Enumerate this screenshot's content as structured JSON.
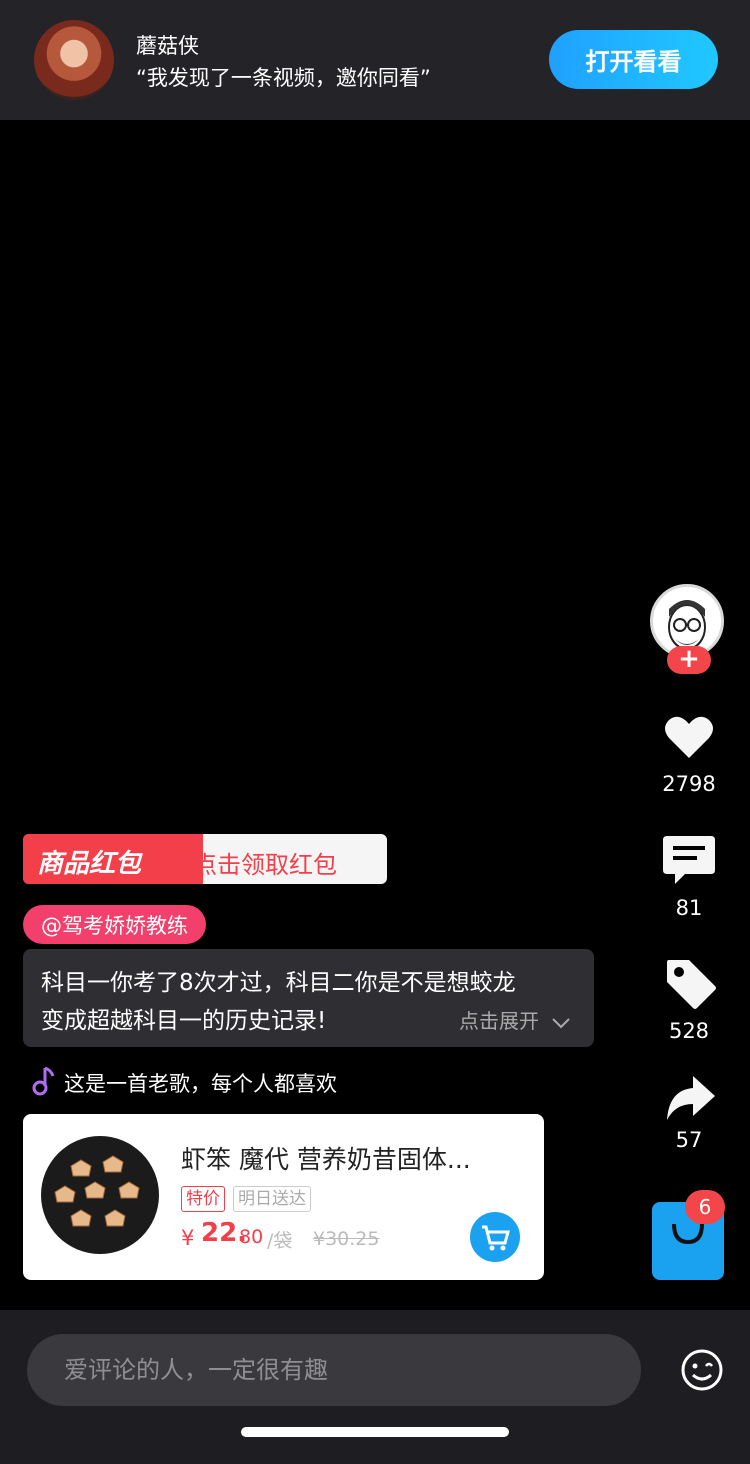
{
  "topbar": {
    "user_name": "蘑菇侠",
    "invite_text": "“我发现了一条视频，邀你同看”",
    "open_button": "打开看看"
  },
  "side": {
    "follow_icon": "+",
    "likes": "2798",
    "comments": "81",
    "tags": "528",
    "shares": "57",
    "cart_badge": "6"
  },
  "promo": {
    "label": "商品红包",
    "action": "点击领取红包"
  },
  "author_tag": "@驾考娇娇教练",
  "caption": {
    "line1": "科目一你考了8次才过，科目二你是不是想蛟龙",
    "line2": "变成超越科目一的历史记录!",
    "expand": "点击展开"
  },
  "music": "这是一首老歌，每个人都喜欢",
  "product": {
    "title": "虾笨 魔代 营养奶昔固体...",
    "tag_special": "特价",
    "tag_delivery": "明日送达",
    "price_symbol": "¥",
    "price_int": "22.",
    "price_dec": "80",
    "price_unit": "/袋",
    "price_old": "¥30.25"
  },
  "comment": {
    "placeholder": "爱评论的人，一定很有趣"
  },
  "colors": {
    "accent_blue": "#1aa1f0",
    "accent_red": "#f23f4a",
    "pink": "#f23f6b"
  }
}
